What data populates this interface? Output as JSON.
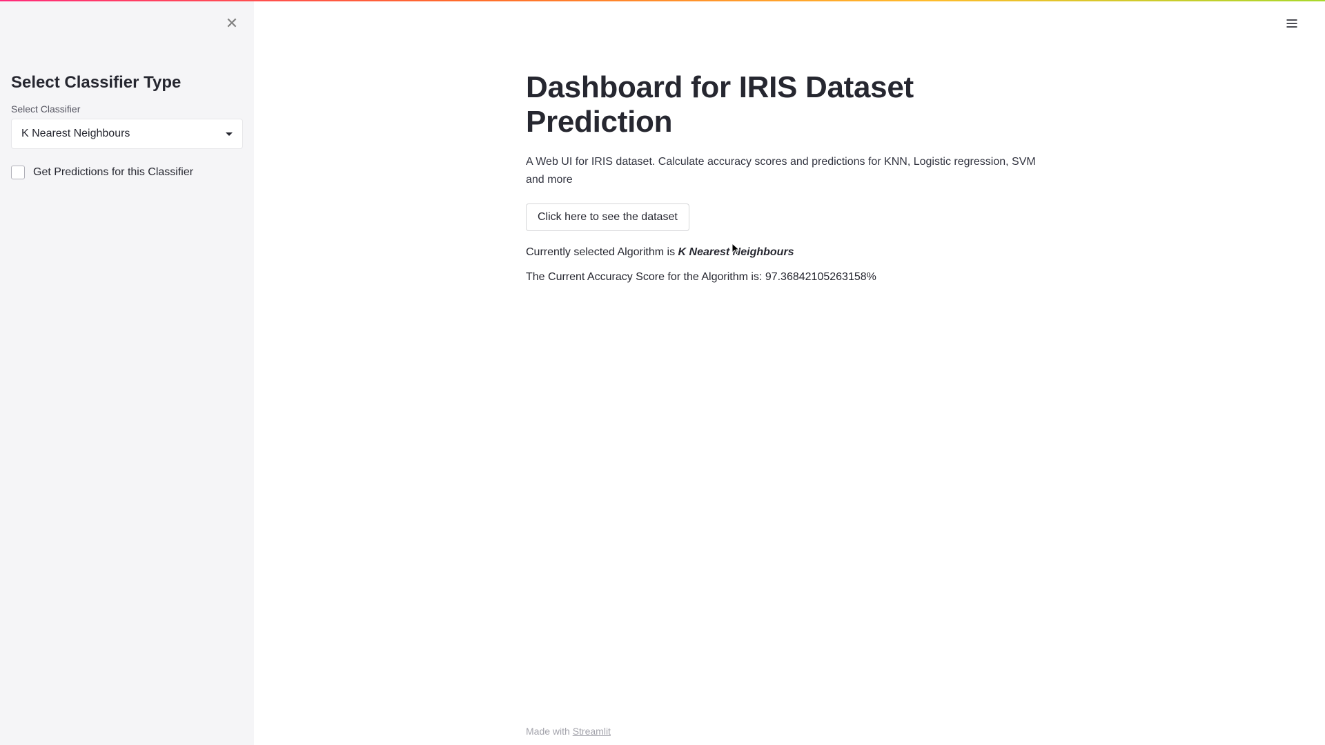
{
  "sidebar": {
    "header": "Select Classifier Type",
    "select_label": "Select Classifier",
    "select_value": "K Nearest Neighbours",
    "checkbox_label": "Get Predictions for this Classifier"
  },
  "main": {
    "title": "Dashboard for IRIS Dataset Prediction",
    "description": "A Web UI for IRIS dataset. Calculate accuracy scores and predictions for KNN, Logistic regression, SVM and more",
    "dataset_button": "Click here to see the dataset",
    "algo_prefix": "Currently selected Algorithm is ",
    "algo_name": "K Nearest Neighbours",
    "accuracy_prefix": "The Current Accuracy Score for the Algorithm is: ",
    "accuracy_value": "97.36842105263158%"
  },
  "footer": {
    "made_with": "Made with ",
    "link_text": "Streamlit"
  }
}
